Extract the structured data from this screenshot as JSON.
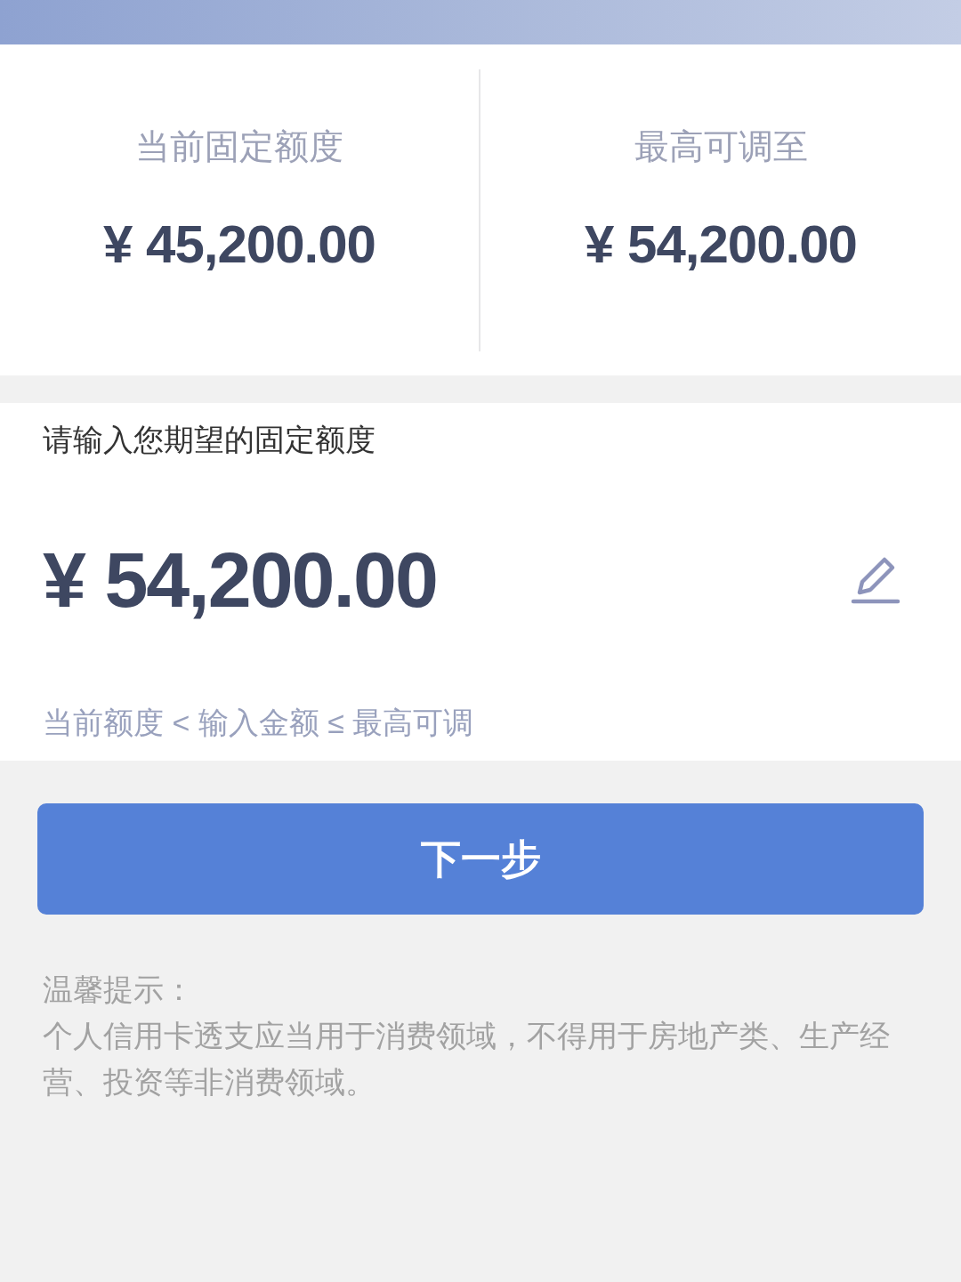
{
  "limits": [
    {
      "label": "当前固定额度",
      "amount": "¥ 45,200.00"
    },
    {
      "label": "最高可调至",
      "amount": "¥ 54,200.00"
    }
  ],
  "amount_entry": {
    "label": "请输入您期望的固定额度",
    "value": "¥ 54,200.00",
    "hint": "当前额度 < 输入金额 ≤ 最高可调"
  },
  "next_button": {
    "label": "下一步"
  },
  "notice": {
    "title": "温馨提示：",
    "text": "个人信用卡透支应当用于消费领域，不得用于房地产类、生产经营、投资等非消费领域。"
  }
}
